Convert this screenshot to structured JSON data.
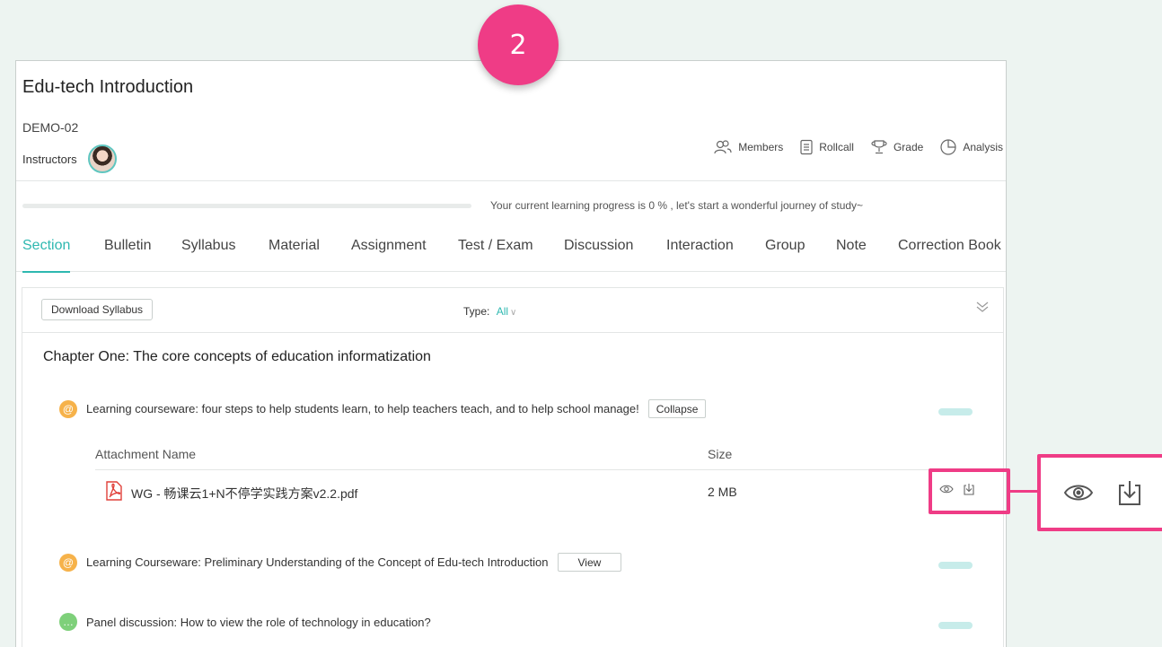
{
  "step_badge": "2",
  "course": {
    "title": "Edu-tech Introduction",
    "code": "DEMO-02",
    "instructors_label": "Instructors"
  },
  "toolbar": {
    "members": "Members",
    "rollcall": "Rollcall",
    "grade": "Grade",
    "analysis": "Analysis"
  },
  "progress": {
    "percent": 0,
    "text": "Your current learning progress is 0 % , let's start a wonderful journey of study~"
  },
  "tabs": [
    "Section",
    "Bulletin",
    "Syllabus",
    "Material",
    "Assignment",
    "Test / Exam",
    "Discussion",
    "Interaction",
    "Group",
    "Note",
    "Correction Book"
  ],
  "active_tab": "Section",
  "content": {
    "download_button": "Download Syllabus",
    "type_label": "Type:",
    "type_value": "All",
    "chapter_title": "Chapter One:  The core concepts of education informatization",
    "items": [
      {
        "title": "Learning courseware: four steps to help students learn, to help teachers teach, and to help school manage!",
        "button": "Collapse",
        "icon": "courseware-icon"
      },
      {
        "title": "Learning Courseware: Preliminary Understanding of the Concept of Edu-tech Introduction",
        "button": "View",
        "icon": "courseware-icon"
      },
      {
        "title": "Panel discussion: How to view the role of technology in education?",
        "icon": "discussion-icon"
      }
    ],
    "attachments": {
      "header_name": "Attachment Name",
      "header_size": "Size",
      "rows": [
        {
          "name": "WG - 畅课云1+N不停学实践方案v2.2.pdf",
          "size": "2 MB"
        }
      ]
    }
  },
  "colors": {
    "accent": "#2eb8b0",
    "highlight": "#ef3c86",
    "background": "#edf4f1"
  }
}
